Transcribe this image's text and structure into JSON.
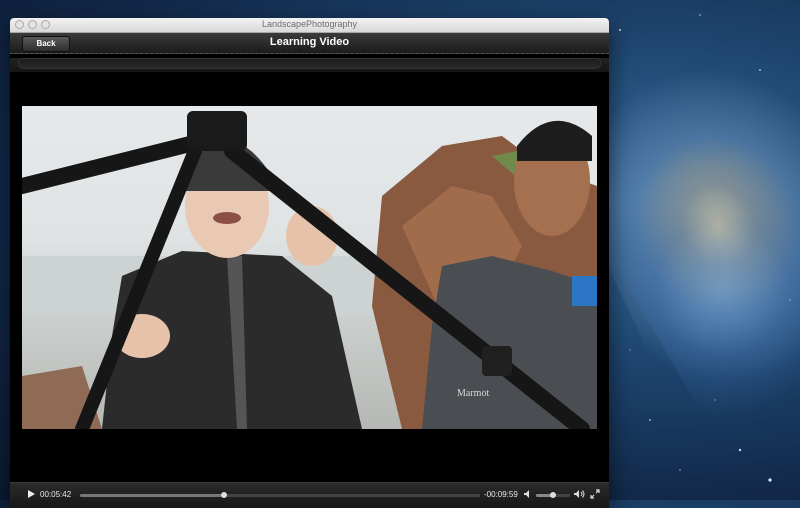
{
  "window": {
    "title": "LandscapePhotography"
  },
  "navbar": {
    "back_label": "Back",
    "title": "Learning Video"
  },
  "video": {
    "jacket_text": "Marmot"
  },
  "controls": {
    "elapsed": "00:05:42",
    "remaining": "-00:09:59",
    "progress_fraction": 0.36,
    "volume_fraction": 0.5
  },
  "icons": {
    "play": "play-icon",
    "volume_low": "volume-low-icon",
    "volume_high": "volume-high-icon",
    "fullscreen": "fullscreen-icon"
  }
}
